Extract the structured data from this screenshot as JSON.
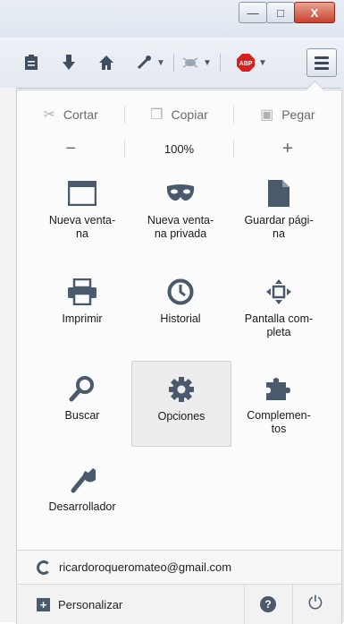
{
  "window": {
    "minimize": "—",
    "maximize": "□",
    "close": "X"
  },
  "toolbar": {
    "icons": [
      "clipboard-icon",
      "download-icon",
      "home-icon",
      "eyedropper-icon",
      "bug-icon",
      "adblock-icon"
    ],
    "abp_label": "ABP"
  },
  "edit": {
    "cut": "Cortar",
    "copy": "Copiar",
    "paste": "Pegar"
  },
  "zoom": {
    "minus": "−",
    "value": "100%",
    "plus": "+"
  },
  "items": [
    {
      "label": "Nueva venta-\nna",
      "icon": "window-icon"
    },
    {
      "label": "Nueva venta-\nna privada",
      "icon": "mask-icon"
    },
    {
      "label": "Guardar pági-\nna",
      "icon": "page-icon"
    },
    {
      "label": "Imprimir",
      "icon": "printer-icon"
    },
    {
      "label": "Historial",
      "icon": "clock-icon"
    },
    {
      "label": "Pantalla com-\npleta",
      "icon": "fullscreen-icon"
    },
    {
      "label": "Buscar",
      "icon": "search-icon"
    },
    {
      "label": "Opciones",
      "icon": "gear-icon"
    },
    {
      "label": "Complemen-\ntos",
      "icon": "puzzle-icon"
    },
    {
      "label": "Desarrollador",
      "icon": "wrench-icon"
    }
  ],
  "account": {
    "email": "ricardoroqueromateo@gmail.com"
  },
  "footer": {
    "customize": "Personalizar",
    "help": "?"
  },
  "colors": {
    "icon": "#4a5a6c",
    "active_bg": "#ededed",
    "abp_red": "#d61f1f"
  }
}
